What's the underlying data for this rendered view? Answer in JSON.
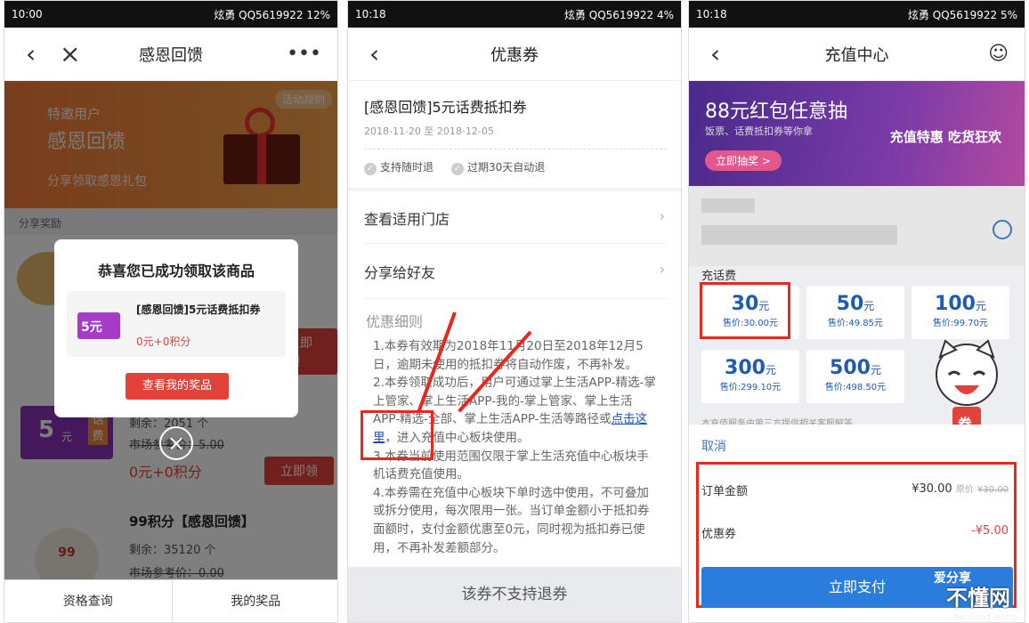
{
  "panel1": {
    "status": {
      "time": "10:00",
      "carrier": "炫勇",
      "account": "QQ5619922",
      "battery": "12%"
    },
    "title": "感恩回馈",
    "more": "•••",
    "banner": {
      "line1": "特邀用户",
      "line2": "感恩回馈",
      "line3": "分享领取感恩礼包",
      "rule": "活动规则"
    },
    "section": "分享奖励",
    "modal": {
      "heading": "恭喜您已成功领取该商品",
      "coupon_title": "[感恩回馈]5元话费抵扣券",
      "price": "0元+0积分",
      "mini": "5元",
      "button": "查看我的奖品"
    },
    "items": [
      {
        "ticket_num": "5",
        "ticket_unit": "元",
        "ticket_side": "话费",
        "remain": "剩余：2051 个",
        "market": "市场参考价：5.00",
        "price": "0元+0积分",
        "button": "立即领"
      },
      {
        "title": "99积分【感恩回馈】",
        "badge": "99",
        "remain": "剩余：35120 个",
        "market": "市场参考价：0.00"
      }
    ],
    "hidden_button": "立即领",
    "footer": {
      "left": "资格查询",
      "right": "我的奖品"
    }
  },
  "panel2": {
    "status": {
      "time": "10:18",
      "carrier": "炫勇",
      "account": "QQ5619922",
      "battery": "4%"
    },
    "title": "优惠券",
    "coupon": {
      "title": "[感恩回馈]5元话费抵扣券",
      "dates": "2018-11-20 至 2018-12-05",
      "tag1": "支持随时退",
      "tag2": "过期30天自动退"
    },
    "rows": [
      "查看适用门店",
      "分享给好友"
    ],
    "detail_title": "优惠细则",
    "detail_p1": "1.本券有效期为2018年11月20日至2018年12月5日，逾期未使用的抵扣券将自动作废，不再补发。",
    "detail_p2a": "2.本券领取成功后，用户可通过掌上生活APP-精选-掌上管家、掌上生活APP-我的-掌上管家、掌上生活APP-精选-全部、掌上生活APP-生活等路径或",
    "detail_link": "点击这里",
    "detail_p2b": "，进入充值中心板块使用。",
    "detail_p3": "3.本券当前使用范围仅限于掌上生活充值中心板块手机话费充值使用。",
    "detail_p4": "4.本券需在充值中心板块下单时选中使用，不可叠加或拆分使用，每次限用一张。当订单金额小于抵扣券面额时，支付金额优惠至0元，同时视为抵扣券已使用，不再补发差额部分。",
    "footer": "该券不支持退券"
  },
  "panel3": {
    "status": {
      "time": "10:18",
      "carrier": "炫勇",
      "account": "QQ5619922",
      "battery": "5%"
    },
    "title": "充值中心",
    "banner": {
      "headline": "88元红包任意抽",
      "sub": "饭票、话费抵扣券等你拿",
      "cta": "立即抽奖 >",
      "promo": "充值特惠 吃货狂欢"
    },
    "section": "充话费",
    "tiles": [
      {
        "amount": "30",
        "unit": "元",
        "sale": "售价:30.00元"
      },
      {
        "amount": "50",
        "unit": "元",
        "sale": "售价:49.85元"
      },
      {
        "amount": "100",
        "unit": "元",
        "sale": "售价:99.70元"
      },
      {
        "amount": "300",
        "unit": "元",
        "sale": "售价:299.10元"
      },
      {
        "amount": "500",
        "unit": "元",
        "sale": "售价:498.50元"
      }
    ],
    "cat_label": "券",
    "note": "本充值服务由第三方提供相关客服解答",
    "cancel": "取消",
    "order_label": "订单金额",
    "order_value": "¥30.00",
    "order_orig_label": "原价",
    "order_orig": "¥30.00",
    "coupon_label": "优惠券",
    "coupon_value": "-¥5.00",
    "pay_button": "立即支付",
    "watermark": "不懂网",
    "watermark2": "爱分享",
    "watermark3": "bu dong wang"
  },
  "colors": {
    "red": "#e2423a",
    "blue": "#2a7ddc",
    "purple": "#8a2fb7"
  }
}
